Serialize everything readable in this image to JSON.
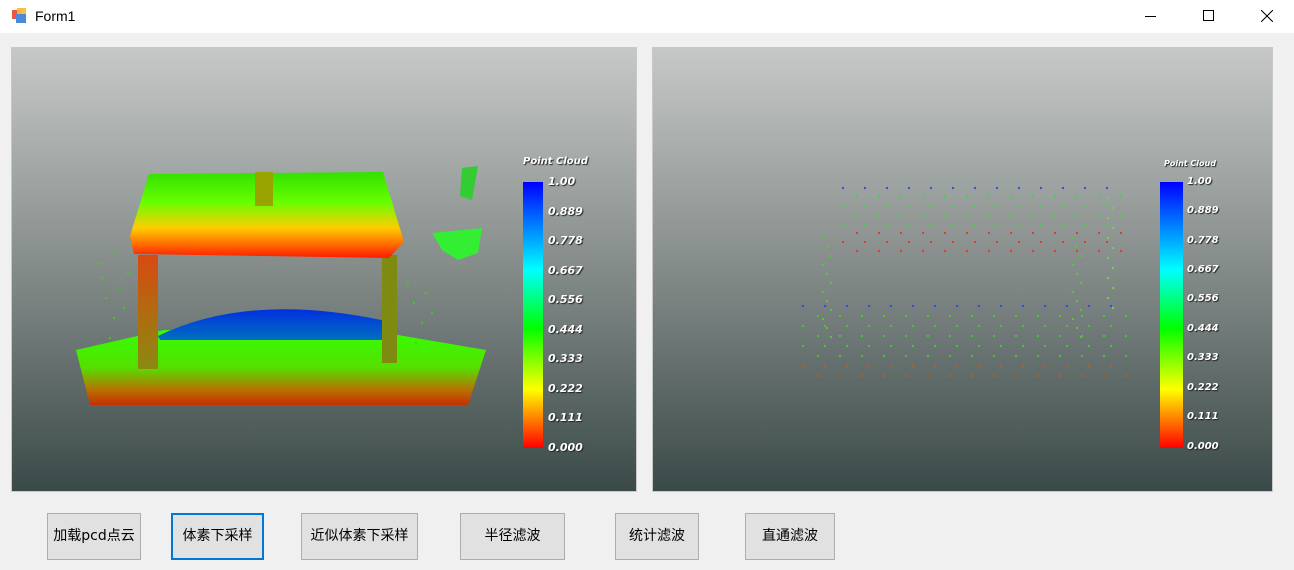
{
  "window": {
    "title": "Form1"
  },
  "viewer_left": {
    "legend_title": "Point Cloud",
    "ticks": [
      "1.00",
      "0.889",
      "0.778",
      "0.667",
      "0.556",
      "0.444",
      "0.333",
      "0.222",
      "0.111",
      "0.000"
    ]
  },
  "viewer_right": {
    "legend_title": "Point Cloud",
    "ticks": [
      "1.00",
      "0.889",
      "0.778",
      "0.667",
      "0.556",
      "0.444",
      "0.333",
      "0.222",
      "0.111",
      "0.000"
    ]
  },
  "buttons": {
    "load_pcd": "加载pcd点云",
    "voxel_downsample": "体素下采样",
    "approx_voxel_downsample": "近似体素下采样",
    "radius_filter": "半径滤波",
    "statistical_filter": "统计滤波",
    "passthrough_filter": "直通滤波"
  },
  "colors": {
    "colormap_top": "#0000ff",
    "colormap_mid": "#00ff00",
    "colormap_bottom": "#ff0000",
    "focus_border": "#0078d7"
  }
}
